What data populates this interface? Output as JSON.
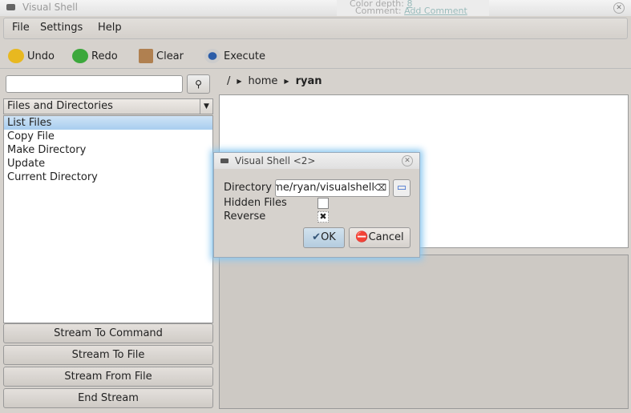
{
  "window": {
    "title": "Visual Shell"
  },
  "background_window": {
    "line1_label": "Color depth:",
    "line1_value": "8",
    "line2_label": "Comment:",
    "line2_value": "Add Comment"
  },
  "menu": [
    "File",
    "Settings",
    "Help"
  ],
  "toolbar": {
    "undo": "Undo",
    "redo": "Redo",
    "clear": "Clear",
    "execute": "Execute"
  },
  "search": {
    "value": "",
    "placeholder": ""
  },
  "category": {
    "selected": "Files and Directories"
  },
  "commands": [
    "List Files",
    "Copy File",
    "Make Directory",
    "Update",
    "Current Directory"
  ],
  "selected_command": "List Files",
  "stream_buttons": [
    "Stream To Command",
    "Stream To File",
    "Stream From File",
    "End Stream"
  ],
  "breadcrumb": [
    "/",
    "home",
    "ryan"
  ],
  "dialog": {
    "title": "Visual Shell <2>",
    "directory_label": "Directory",
    "directory_value": "/home/ryan/visualshell",
    "hidden_label": "Hidden Files",
    "hidden_checked": false,
    "reverse_label": "Reverse",
    "reverse_checked": true,
    "ok": "OK",
    "cancel": "Cancel"
  }
}
